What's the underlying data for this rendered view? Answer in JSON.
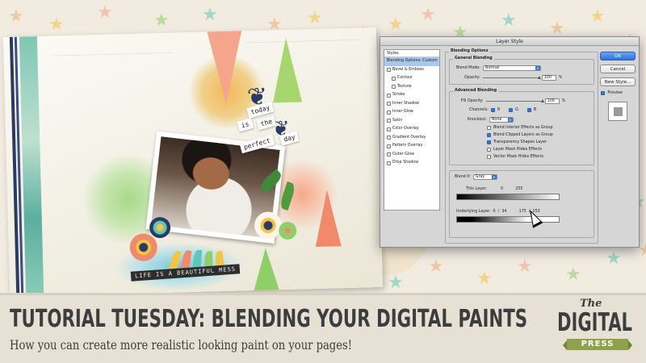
{
  "banner": {
    "title": "TUTORIAL TUESDAY: BLENDING YOUR DIGITAL PAINTS",
    "subtitle": "How you can create more realistic looking paint on your pages!"
  },
  "logo": {
    "the": "The",
    "digital": "DIGITAL",
    "press": "PRESS",
    "accent_color": "#8da24a"
  },
  "scrapbook": {
    "word_tags": [
      "today",
      "is",
      "the",
      "perfect",
      "day"
    ],
    "bottom_tag": "LIFE IS A BEAUTIFUL MESS",
    "colors": [
      "#f08a6a",
      "#5fc7b8",
      "#8ecf6a",
      "#f2c44a",
      "#2b3a63"
    ]
  },
  "dialog": {
    "title": "Layer Style",
    "styles_header": "Styles",
    "style_items": [
      {
        "label": "Blending Options: Custom",
        "selected": true,
        "checkbox": false,
        "indent": false
      },
      {
        "label": "Bevel & Emboss",
        "checkbox": true,
        "checked": false,
        "indent": false
      },
      {
        "label": "Contour",
        "checkbox": true,
        "checked": false,
        "indent": true
      },
      {
        "label": "Texture",
        "checkbox": true,
        "checked": false,
        "indent": true
      },
      {
        "label": "Stroke",
        "checkbox": true,
        "checked": false,
        "indent": false
      },
      {
        "label": "Inner Shadow",
        "checkbox": true,
        "checked": false,
        "indent": false
      },
      {
        "label": "Inner Glow",
        "checkbox": true,
        "checked": false,
        "indent": false
      },
      {
        "label": "Satin",
        "checkbox": true,
        "checked": false,
        "indent": false
      },
      {
        "label": "Color Overlay",
        "checkbox": true,
        "checked": false,
        "indent": false
      },
      {
        "label": "Gradient Overlay",
        "checkbox": true,
        "checked": false,
        "indent": false
      },
      {
        "label": "Pattern Overlay",
        "checkbox": true,
        "checked": false,
        "indent": false
      },
      {
        "label": "Outer Glow",
        "checkbox": true,
        "checked": false,
        "indent": false
      },
      {
        "label": "Drop Shadow",
        "checkbox": true,
        "checked": false,
        "indent": false
      }
    ],
    "blending_options": {
      "title": "Blending Options",
      "general": {
        "title": "General Blending",
        "blend_mode_label": "Blend Mode:",
        "blend_mode_value": "Normal",
        "opacity_label": "Opacity:",
        "opacity_value": "100",
        "opacity_unit": "%"
      },
      "advanced": {
        "title": "Advanced Blending",
        "fill_opacity_label": "Fill Opacity:",
        "fill_opacity_value": "100",
        "fill_opacity_unit": "%",
        "channels_label": "Channels:",
        "channels": [
          "R",
          "G",
          "B"
        ],
        "knockout_label": "Knockout:",
        "knockout_value": "None",
        "options": [
          {
            "label": "Blend Interior Effects as Group",
            "checked": false
          },
          {
            "label": "Blend Clipped Layers as Group",
            "checked": true
          },
          {
            "label": "Transparency Shapes Layer",
            "checked": true
          },
          {
            "label": "Layer Mask Hides Effects",
            "checked": false
          },
          {
            "label": "Vector Mask Hides Effects",
            "checked": false
          }
        ]
      },
      "blend_if": {
        "label": "Blend If:",
        "value": "Gray",
        "this_layer_label": "This Layer:",
        "this_layer_values": "0          255",
        "underlying_label": "Underlying Layer:",
        "underlying_values": "0  /  34          175  /  253"
      }
    },
    "buttons": {
      "ok": "OK",
      "cancel": "Cancel",
      "new_style": "New Style...",
      "preview": "Preview"
    }
  }
}
